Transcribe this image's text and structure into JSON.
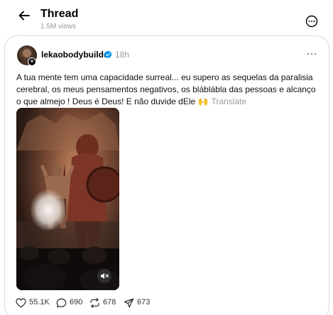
{
  "header": {
    "title": "Thread",
    "views": "1.5M views"
  },
  "post": {
    "username": "lekaobodybuilder",
    "timestamp": "18h",
    "text": "A tua mente tem uma capacidade surreal... eu supero as sequelas da paralisia cerebral, os meus pensamentos negativos, os bláblábla das pessoas e alcanço o que almejo ! Deus é Deus! E não duvide dEle 🙌",
    "translate_label": "Translate",
    "media_type": "video",
    "media_muted": true
  },
  "actions": {
    "likes": "55.1K",
    "replies": "690",
    "reposts": "678",
    "shares": "673"
  },
  "icons": {
    "back": "arrow-left-icon",
    "more_options": "more-circle-icon",
    "post_more": "ellipsis-icon",
    "verified": "verified-badge-icon",
    "mute": "speaker-muted-icon",
    "like": "heart-icon",
    "reply": "comment-icon",
    "repost": "repost-icon",
    "share": "send-icon"
  },
  "colors": {
    "verified": "#0095f6",
    "muted_text": "#999999",
    "card_border": "#d9d9d9"
  }
}
